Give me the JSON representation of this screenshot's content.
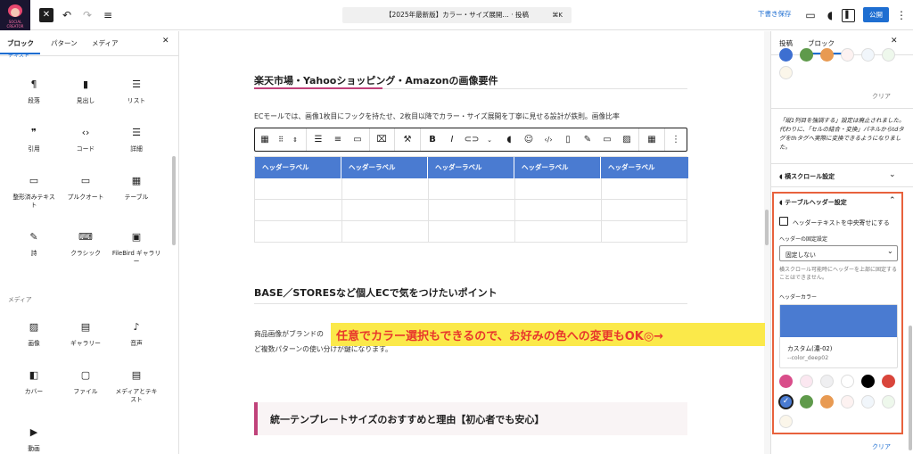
{
  "topbar": {
    "title": "【2025年最新版】カラー・サイズ展開… · 投稿",
    "shortcut": "⌘K",
    "draft": "下書き保存",
    "publish": "公開",
    "logo_text": "SOCIAL CREATOR"
  },
  "inserter": {
    "tabs": [
      "ブロック",
      "パターン",
      "メディア"
    ],
    "cat_text": "テキスト",
    "cat_media": "メディア",
    "text_blocks": [
      {
        "label": "段落",
        "icon": "¶"
      },
      {
        "label": "見出し",
        "icon": "▮"
      },
      {
        "label": "リスト",
        "icon": "☰"
      },
      {
        "label": "引用",
        "icon": "❞"
      },
      {
        "label": "コード",
        "icon": "‹›"
      },
      {
        "label": "詳細",
        "icon": "☰"
      },
      {
        "label": "整形済みテキスト",
        "icon": "▭"
      },
      {
        "label": "プルクオート",
        "icon": "▭"
      },
      {
        "label": "テーブル",
        "icon": "▦"
      },
      {
        "label": "詩",
        "icon": "✎"
      },
      {
        "label": "クラシック",
        "icon": "⌨"
      },
      {
        "label": "FileBird ギャラリー",
        "icon": "▣"
      }
    ],
    "media_blocks": [
      {
        "label": "画像",
        "icon": "▨"
      },
      {
        "label": "ギャラリー",
        "icon": "▤"
      },
      {
        "label": "音声",
        "icon": "♪"
      },
      {
        "label": "カバー",
        "icon": "◧"
      },
      {
        "label": "ファイル",
        "icon": "▢"
      },
      {
        "label": "メディアとテキスト",
        "icon": "▤"
      },
      {
        "label": "動画",
        "icon": "▶"
      }
    ]
  },
  "editor": {
    "heading1": "楽天市場・Yahooショッピング・Amazonの画像要件",
    "para1": "ECモールでは、画像1枚目にフックを持たせ、2枚目以降でカラー・サイズ展開を丁寧に見せる設計が鉄則。画像比率",
    "table_headers": [
      "ヘッダーラベル",
      "ヘッダーラベル",
      "ヘッダーラベル",
      "ヘッダーラベル",
      "ヘッダーラベル"
    ],
    "heading2": "BASE／STORESなど個人ECで気をつけたいポイント",
    "para2a": "商品画像がブランドの",
    "para2b": "ど複数パターンの使い分けが鍵になります。",
    "heading3": "統一テンプレートサイズのおすすめと理由【初心者でも安心】",
    "annotation": "任意でカラー選択もできるので、お好みの色への変更もOK◎→"
  },
  "settings": {
    "tabs": [
      "投稿",
      "ブロック"
    ],
    "clear": "クリア",
    "note": "「縦1列目を強調する」設定は廃止されました。代わりに、「セルの結合・変換」パネルからtdタグをthタグへ実際に変換できるようになりました。",
    "scroll_panel": "横スクロール設定",
    "header_panel": "テーブルヘッダー設定",
    "center_check": "ヘッダーテキストを中央寄せにする",
    "fix_label": "ヘッダーの固定設定",
    "fix_value": "固定しない",
    "fix_help": "横スクロール可能時にヘッダーを上部に固定することはできません。",
    "color_label": "ヘッダーカラー",
    "color_name": "カスタム(濃-02)",
    "color_var": "--color_deep02",
    "clear2": "クリア"
  },
  "colors": {
    "accent": "#1e6ed1",
    "header": "#4a7bd1",
    "annotation_bg": "#fbe94a",
    "annotation_text": "#e8372c",
    "panel_border": "#e8623d",
    "heading_mark": "#c0427a",
    "top_swatches": [
      "#3d6fd1",
      "#5f9a4b",
      "#e89a52",
      "#fdf2f1",
      "#f1f6fb",
      "#eef8ec",
      "#fbf6ea"
    ],
    "swatches": [
      "#d94d8a",
      "#fbe7f0",
      "#efeff1",
      "#ffffff",
      "#000000",
      "#d9453b",
      "#4a7bd1",
      "#5f9a4b",
      "#e89a52",
      "#fdf2f1",
      "#f1f6fb",
      "#eef8ec",
      "#fbf6ea"
    ]
  }
}
